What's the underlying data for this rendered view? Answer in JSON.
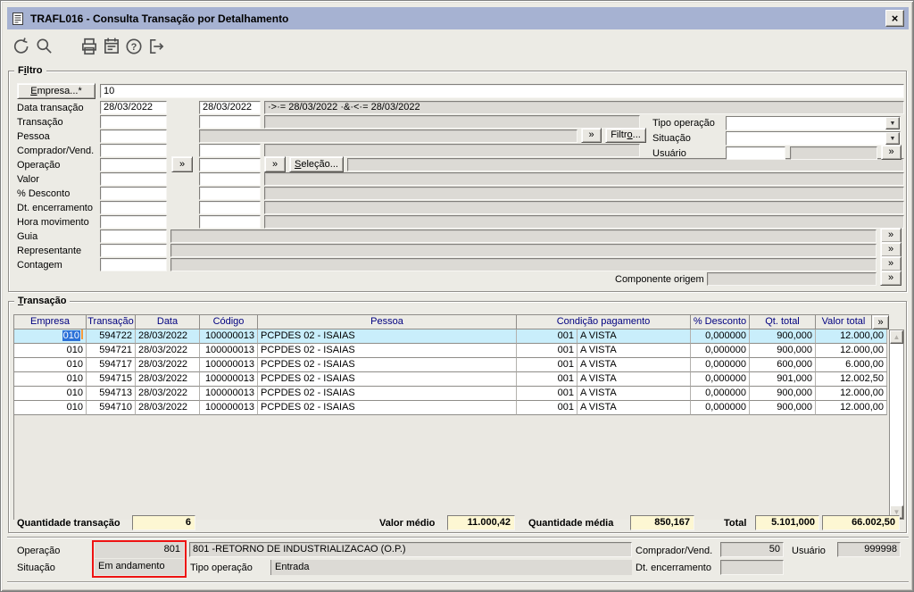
{
  "window": {
    "title": "TRAFL016 - Consulta Transação por Detalhamento",
    "close_glyph": "×"
  },
  "icons": {
    "expand": "»",
    "combo_arrow": "▼",
    "scroll_up": "▲",
    "scroll_down": "▼"
  },
  "filter": {
    "label": "Filtro",
    "empresa_button": "Empresa...*",
    "empresa_value": "10",
    "date_from": "28/03/2022",
    "date_to": "28/03/2022",
    "date_expr": "·>·= 28/03/2022 ·&·<·= 28/03/2022",
    "selecao_button": "Seleção...",
    "filtro_button": "Filtro...",
    "rows": {
      "data_transacao": "Data transação",
      "transacao": "Transação",
      "pessoa": "Pessoa",
      "comprador": "Comprador/Vend.",
      "operacao": "Operação",
      "valor": "Valor",
      "desconto": "% Desconto",
      "dt_encerramento": "Dt. encerramento",
      "hora_movimento": "Hora movimento",
      "guia": "Guia",
      "representante": "Representante",
      "contagem": "Contagem",
      "componente_origem": "Componente origem",
      "tipo_operacao": "Tipo operação",
      "situacao": "Situação",
      "usuario": "Usuário"
    }
  },
  "table": {
    "label": "Transação",
    "headers": {
      "empresa": "Empresa",
      "transacao": "Transação",
      "data": "Data",
      "codigo": "Código",
      "pessoa": "Pessoa",
      "condicao": "Condição pagamento",
      "desconto": "% Desconto",
      "qt": "Qt. total",
      "valor": "Valor total",
      "more": "»"
    },
    "rows": [
      {
        "empresa": "010",
        "transacao": "594722",
        "data": "28/03/2022",
        "codigo": "100000013",
        "pessoa": "PCPDES 02 - ISAIAS",
        "cond_cod": "001",
        "cond_desc": "A VISTA",
        "desconto": "0,000000",
        "qt": "900,000",
        "valor": "12.000,00"
      },
      {
        "empresa": "010",
        "transacao": "594721",
        "data": "28/03/2022",
        "codigo": "100000013",
        "pessoa": "PCPDES 02 - ISAIAS",
        "cond_cod": "001",
        "cond_desc": "A VISTA",
        "desconto": "0,000000",
        "qt": "900,000",
        "valor": "12.000,00"
      },
      {
        "empresa": "010",
        "transacao": "594717",
        "data": "28/03/2022",
        "codigo": "100000013",
        "pessoa": "PCPDES 02 - ISAIAS",
        "cond_cod": "001",
        "cond_desc": "A VISTA",
        "desconto": "0,000000",
        "qt": "600,000",
        "valor": "6.000,00"
      },
      {
        "empresa": "010",
        "transacao": "594715",
        "data": "28/03/2022",
        "codigo": "100000013",
        "pessoa": "PCPDES 02 - ISAIAS",
        "cond_cod": "001",
        "cond_desc": "A VISTA",
        "desconto": "0,000000",
        "qt": "901,000",
        "valor": "12.002,50"
      },
      {
        "empresa": "010",
        "transacao": "594713",
        "data": "28/03/2022",
        "codigo": "100000013",
        "pessoa": "PCPDES 02 - ISAIAS",
        "cond_cod": "001",
        "cond_desc": "A VISTA",
        "desconto": "0,000000",
        "qt": "900,000",
        "valor": "12.000,00"
      },
      {
        "empresa": "010",
        "transacao": "594710",
        "data": "28/03/2022",
        "codigo": "100000013",
        "pessoa": "PCPDES 02 - ISAIAS",
        "cond_cod": "001",
        "cond_desc": "A VISTA",
        "desconto": "0,000000",
        "qt": "900,000",
        "valor": "12.000,00"
      }
    ]
  },
  "summary": {
    "qt_label": "Quantidade transação",
    "qt_value": "6",
    "vm_label": "Valor médio",
    "vm_value": "11.000,42",
    "qm_label": "Quantidade média",
    "qm_value": "850,167",
    "total_label": "Total",
    "total_qt": "5.101,000",
    "total_value": "66.002,50"
  },
  "footer": {
    "operacao_label": "Operação",
    "situacao_label": "Situação",
    "operacao_code": "801",
    "situacao_value": "Em andamento",
    "operacao_desc": "801 -RETORNO DE INDUSTRIALIZACAO (O.P.)",
    "tipo_operacao_label": "Tipo operação",
    "tipo_operacao_value": "Entrada",
    "comprador_label": "Comprador/Vend.",
    "comprador_value": "50",
    "usuario_label": "Usuário",
    "usuario_value": "999998",
    "dt_encerramento_label": "Dt. encerramento"
  }
}
